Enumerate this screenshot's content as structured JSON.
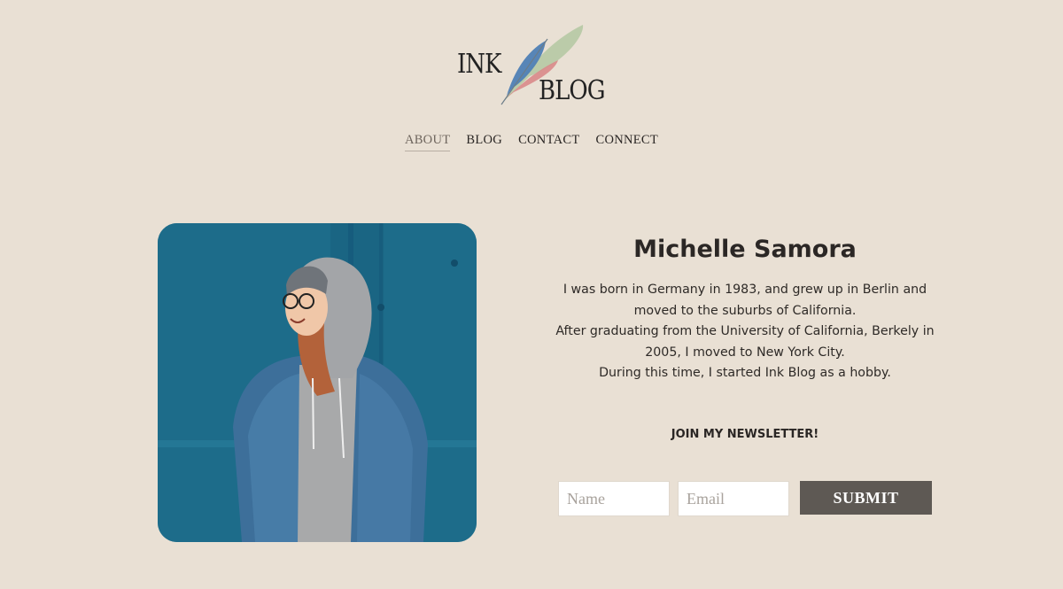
{
  "logo": {
    "line1": "INK",
    "line2": "BLOG"
  },
  "nav": {
    "items": [
      {
        "label": "ABOUT",
        "active": true
      },
      {
        "label": "BLOG"
      },
      {
        "label": "CONTACT"
      },
      {
        "label": "CONNECT"
      }
    ]
  },
  "profile": {
    "name": "Michelle Samora",
    "bio_lines": [
      "I was born in Germany in 1983, and grew up in Berlin and moved to the suburbs of California.",
      "After graduating from the University of California, Berkely in 2005, I moved to New York City.",
      "During this time, I started Ink Blog as a hobby."
    ]
  },
  "newsletter": {
    "heading": "JOIN MY NEWSLETTER!",
    "name_placeholder": "Name",
    "email_placeholder": "Email",
    "submit_label": "SUBMIT"
  },
  "colors": {
    "background": "#e9e0d4",
    "button": "#5e5954",
    "text": "#2a2624"
  }
}
